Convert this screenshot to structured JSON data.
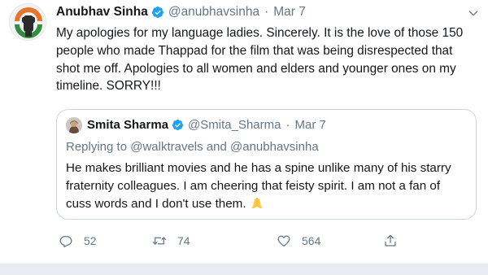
{
  "tweet": {
    "author": {
      "name": "Anubhav Sinha",
      "handle": "@anubhavsinha",
      "separator": "·",
      "date": "Mar 7"
    },
    "text": "My apologies for my language ladies. Sincerely. It is the love of those 150 people who made Thappad for the film that was being disrespected that shot me off. Apologies to all women and elders and younger ones on my timeline. SORRY!!!",
    "quoted": {
      "name": "Smita Sharma",
      "handle": "@Smita_Sharma",
      "separator": "·",
      "date": "Mar 7",
      "replying_prefix": "Replying to",
      "replying_to_1": "@walktravels",
      "replying_and": "and",
      "replying_to_2": "@anubhavsinha",
      "text": "He makes brilliant movies and he has a spine unlike many of his starry fraternity colleagues. I am cheering that feisty spirit. I am not a fan of cuss words and I don't use them.",
      "emoji": "folded-hands-emoji"
    },
    "actions": {
      "replies": "52",
      "retweets": "74",
      "likes": "564",
      "icons": [
        "reply-icon",
        "retweet-icon",
        "like-icon",
        "share-icon"
      ]
    }
  },
  "colors": {
    "text": "#14171a",
    "secondary": "#657786",
    "verified": "#1da1f2",
    "border": "#ccd6dd",
    "band": "#e9edf1"
  }
}
